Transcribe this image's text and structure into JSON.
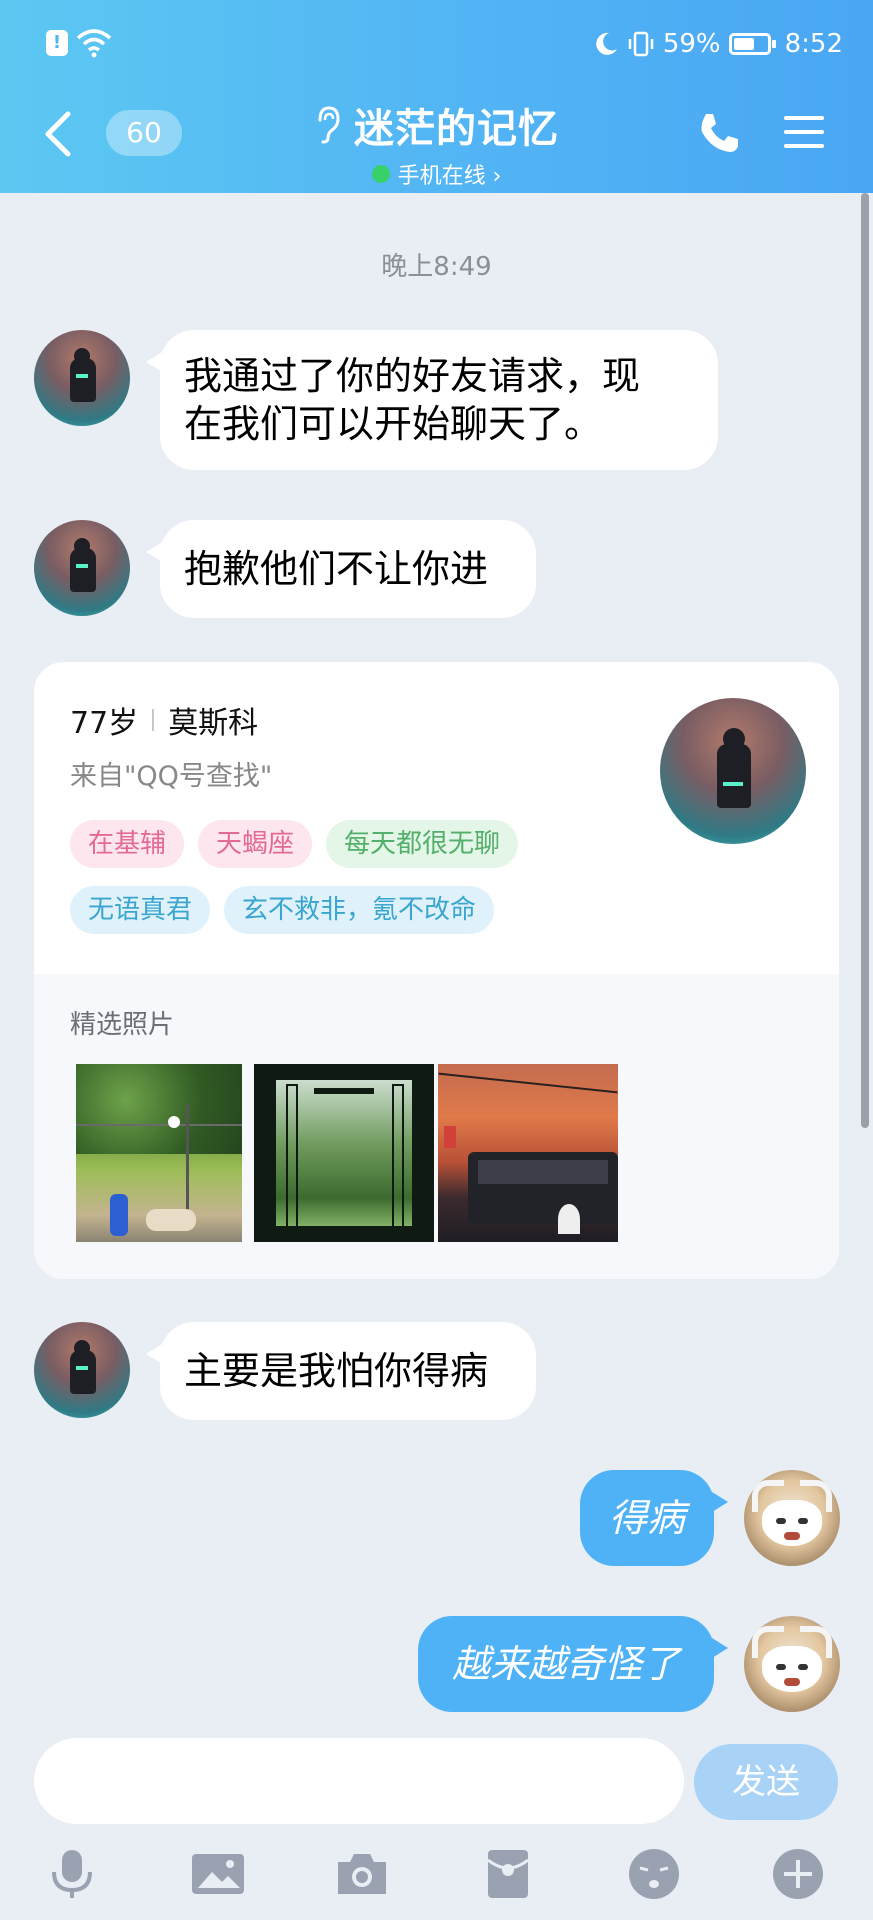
{
  "status_bar": {
    "battery": "59%",
    "time": "8:52"
  },
  "header": {
    "unread_count": "60",
    "contact_name": "迷茫的记忆",
    "online_status": "手机在线 ›"
  },
  "chat": {
    "timestamp": "晚上8:49",
    "messages": [
      {
        "side": "left",
        "text_line1": "我通过了你的好友请求，现",
        "text_line2": "在我们可以开始聊天了。"
      },
      {
        "side": "left",
        "text": "抱歉他们不让你进"
      },
      {
        "side": "left",
        "text": "主要是我怕你得病"
      },
      {
        "side": "right",
        "text": "得病"
      },
      {
        "side": "right",
        "text": "越来越奇怪了"
      }
    ]
  },
  "profile_card": {
    "age": "77岁",
    "city": "莫斯科",
    "source": "来自\"QQ号查找\"",
    "tags": [
      {
        "text": "在基辅",
        "bg": "#fde6ee",
        "color": "#e46a96"
      },
      {
        "text": "天蝎座",
        "bg": "#fde6ee",
        "color": "#e46a96"
      },
      {
        "text": "每天都很无聊",
        "bg": "#e3f6e7",
        "color": "#52b06a"
      },
      {
        "text": "无语真君",
        "bg": "#dff2fb",
        "color": "#3aa6cf"
      },
      {
        "text": "玄不救非，氪不改命",
        "bg": "#dff2fb",
        "color": "#3aa6cf"
      }
    ],
    "photos_label": "精选照片"
  },
  "input_bar": {
    "placeholder": "",
    "send_label": "发送"
  },
  "toolbar": [
    "microphone-icon",
    "image-icon",
    "camera-icon",
    "red-packet-icon",
    "emoji-icon",
    "plus-icon"
  ],
  "colors": {
    "header_start": "#5cc8f2",
    "header_end": "#4aa6f3",
    "bubble_self": "#4fb2f6",
    "chat_bg": "#e9edf4"
  }
}
